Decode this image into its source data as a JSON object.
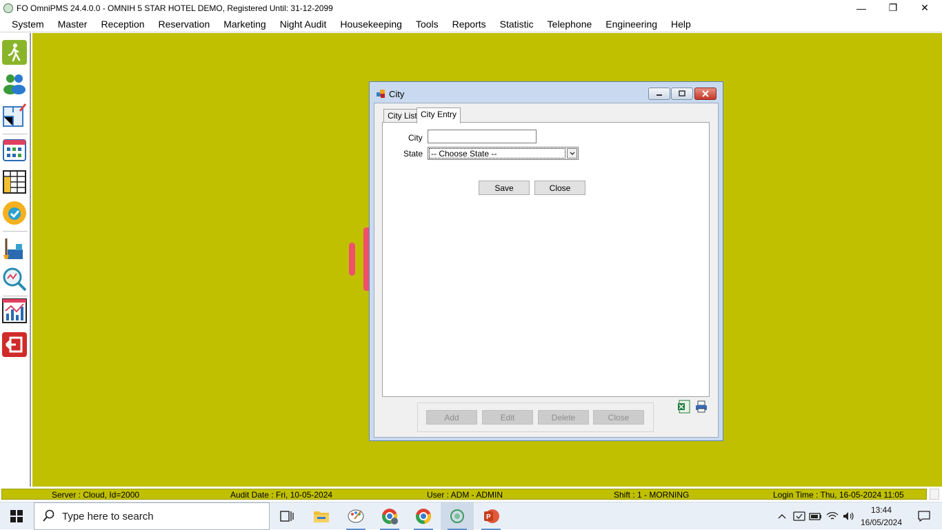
{
  "window": {
    "title": "FO OmniPMS 24.4.0.0 - OMNIH 5 STAR HOTEL DEMO, Registered Until: 31-12-2099",
    "controls": {
      "minimize": "—",
      "maximize": "❐",
      "close": "✕"
    }
  },
  "menu": {
    "items": [
      "System",
      "Master",
      "Reception",
      "Reservation",
      "Marketing",
      "Night Audit",
      "Housekeeping",
      "Tools",
      "Reports",
      "Statistic",
      "Telephone",
      "Engineering",
      "Help"
    ]
  },
  "sidebar": {
    "icons": [
      "walk-in-icon",
      "guests-icon",
      "floor-plan-icon",
      "room-calendar-icon",
      "year-calendar-icon",
      "availability-icon",
      "housekeeping-icon",
      "search-analytics-icon",
      "statistics-chart-icon",
      "exit-icon"
    ]
  },
  "dialog": {
    "title": "City",
    "tabs": [
      "City List",
      "City Entry"
    ],
    "active_tab": "City Entry",
    "form": {
      "city_label": "City",
      "city_value": "",
      "state_label": "State",
      "state_selected": "-- Choose State --"
    },
    "buttons": {
      "save": "Save",
      "close": "Close"
    },
    "bottom_buttons": [
      "Add",
      "Edit",
      "Delete",
      "Close"
    ],
    "export_icons": [
      "excel-export-icon",
      "print-icon"
    ]
  },
  "status": {
    "server": "Server : Cloud, Id=2000",
    "audit_date": "Audit Date : Fri, 10-05-2024",
    "user": "User : ADM - ADMIN",
    "shift": "Shift : 1 - MORNING",
    "login_time": "Login Time : Thu, 16-05-2024 11:05"
  },
  "taskbar": {
    "search_placeholder": "Type here to search",
    "apps": [
      "task-view-icon",
      "file-explorer-icon",
      "paint-icon",
      "chrome-profile-icon",
      "chrome-icon",
      "omnipms-icon",
      "powerpoint-icon"
    ],
    "tray": [
      "chevron-up-icon",
      "security-icon",
      "battery-icon",
      "wifi-icon",
      "volume-icon"
    ],
    "time": "13:44",
    "date": "16/05/2024"
  },
  "colors": {
    "workspace": "#c0c000",
    "accent_red": "#f0506a",
    "dialog_frame": "#c9daf0"
  }
}
